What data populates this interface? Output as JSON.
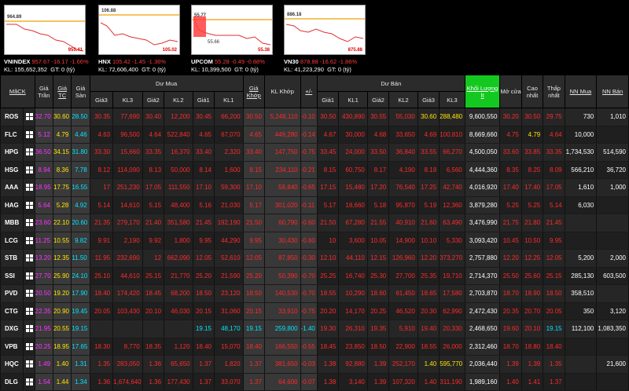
{
  "indices": [
    {
      "name": "VNINDEX",
      "value": "957.67",
      "change": "-16.17",
      "pct": "-1.66%",
      "kl": "KL: 155,652,352",
      "gt": "GT: 0 (tỷ)",
      "hi": "964.89",
      "lo": "955.41",
      "mid": ""
    },
    {
      "name": "HNX",
      "value": "105.42",
      "change": "-1.45",
      "pct": "-1.36%",
      "kl": "KL: 72,606,400",
      "gt": "GT: 0 (tỷ)",
      "hi": "106.88",
      "lo": "105.02",
      "mid": ""
    },
    {
      "name": "UPCOM",
      "value": "55.28",
      "change": "-0.49",
      "pct": "-0.88%",
      "kl": "KL: 10,399,500",
      "gt": "GT: 0 (tỷ)",
      "hi": "55.77",
      "lo": "55.38",
      "mid": "55.66"
    },
    {
      "name": "VN30",
      "value": "878.88",
      "change": "-16.62",
      "pct": "-1.86%",
      "kl": "KL: 41,223,290",
      "gt": "GT: 0 (tỷ)",
      "hi": "886.18",
      "lo": "875.88",
      "mid": ""
    }
  ],
  "headers": {
    "mack": "MãCK",
    "tran": "Giá Trần",
    "tc": "Giá TC",
    "san": "Giá Sàn",
    "du_mua": "Dư Mua",
    "khop": "Giá Khớp",
    "kl_khop": "KL Khớp",
    "pm": "+/-",
    "du_ban": "Dư Bán",
    "kl_tong": "Khối Lượng lt",
    "mo": "Mở cửa",
    "cao": "Cao nhất",
    "thap": "Thấp nhất",
    "nn_mua": "NN Mua",
    "nn_ban": "NN Bán",
    "sub": [
      "Giá3",
      "KL3",
      "Giá2",
      "KL2",
      "Giá1",
      "KL1",
      "Giá1",
      "KL1",
      "Giá2",
      "KL2",
      "Giá3",
      "KL3"
    ]
  },
  "rows": [
    {
      "sym": "ROS",
      "v": [
        "32.70",
        "30.60",
        "28.50",
        "30.35",
        "77,690",
        "30.40",
        "12,200",
        "30.45",
        "66,200",
        "30.50",
        "5,248,110",
        "-0.10",
        "30.50",
        "430,890",
        "30.55",
        "55,030",
        "30.60",
        "288,480",
        "9,600,550",
        "30.20",
        "30.50",
        "29.75",
        "730",
        "1,010"
      ],
      "k": [
        "p",
        "y",
        "c",
        "r",
        "r",
        "r",
        "r",
        "r",
        "r",
        "r",
        "r",
        "r",
        "r",
        "r",
        "r",
        "r",
        "y",
        "y",
        "w",
        "r",
        "r",
        "r",
        "w",
        "w"
      ]
    },
    {
      "sym": "FLC",
      "v": [
        "5.12",
        "4.79",
        "4.46",
        "4.63",
        "96,500",
        "4.64",
        "522,840",
        "4.65",
        "67,070",
        "4.65",
        "449,280",
        "-0.14",
        "4.67",
        "30,000",
        "4.68",
        "33,650",
        "4.69",
        "100,810",
        "8,669,660",
        "4.75",
        "4.79",
        "4.64",
        "10,000",
        ""
      ],
      "k": [
        "p",
        "y",
        "c",
        "r",
        "r",
        "r",
        "r",
        "r",
        "r",
        "r",
        "r",
        "r",
        "r",
        "r",
        "r",
        "r",
        "r",
        "r",
        "w",
        "r",
        "y",
        "r",
        "w",
        "w"
      ]
    },
    {
      "sym": "HPG",
      "v": [
        "36.50",
        "34.15",
        "31.80",
        "33.30",
        "15,660",
        "33.35",
        "16,370",
        "33.40",
        "2,320",
        "33.40",
        "147,750",
        "-0.75",
        "33.45",
        "24,000",
        "33.50",
        "36,840",
        "33.55",
        "66,270",
        "4,500,050",
        "33.60",
        "33.85",
        "33.35",
        "1,734,530",
        "514,590"
      ],
      "k": [
        "p",
        "y",
        "c",
        "r",
        "r",
        "r",
        "r",
        "r",
        "r",
        "r",
        "r",
        "r",
        "r",
        "r",
        "r",
        "r",
        "r",
        "r",
        "w",
        "r",
        "r",
        "r",
        "w",
        "w"
      ]
    },
    {
      "sym": "HSG",
      "v": [
        "8.94",
        "8.36",
        "7.78",
        "8.12",
        "114,090",
        "8.13",
        "50,000",
        "8.14",
        "1,600",
        "8.15",
        "234,110",
        "-0.21",
        "8.15",
        "60,750",
        "8.17",
        "4,190",
        "8.18",
        "6,560",
        "4,444,360",
        "8.35",
        "8.25",
        "8.09",
        "566,210",
        "36,720"
      ],
      "k": [
        "p",
        "y",
        "c",
        "r",
        "r",
        "r",
        "r",
        "r",
        "r",
        "r",
        "r",
        "r",
        "r",
        "r",
        "r",
        "r",
        "r",
        "r",
        "w",
        "r",
        "r",
        "r",
        "w",
        "w"
      ]
    },
    {
      "sym": "AAA",
      "v": [
        "18.95",
        "17.75",
        "16.55",
        "17",
        "251,230",
        "17.05",
        "111,550",
        "17.10",
        "59,300",
        "17.10",
        "58,840",
        "-0.65",
        "17.15",
        "15,480",
        "17.20",
        "76,540",
        "17.25",
        "42,740",
        "4,016,920",
        "17.40",
        "17.40",
        "17.05",
        "1,610",
        "1,000"
      ],
      "k": [
        "p",
        "y",
        "c",
        "r",
        "r",
        "r",
        "r",
        "r",
        "r",
        "r",
        "r",
        "r",
        "r",
        "r",
        "r",
        "r",
        "r",
        "r",
        "w",
        "r",
        "r",
        "r",
        "w",
        "w"
      ]
    },
    {
      "sym": "HAG",
      "v": [
        "5.64",
        "5.28",
        "4.92",
        "5.14",
        "14,610",
        "5.15",
        "48,400",
        "5.16",
        "21,030",
        "5.17",
        "301,020",
        "-0.11",
        "5.17",
        "18,660",
        "5.18",
        "95,870",
        "5.19",
        "12,360",
        "3,879,280",
        "5.25",
        "5.25",
        "5.14",
        "6,030",
        ""
      ],
      "k": [
        "p",
        "y",
        "c",
        "r",
        "r",
        "r",
        "r",
        "r",
        "r",
        "r",
        "r",
        "r",
        "r",
        "r",
        "r",
        "r",
        "r",
        "r",
        "w",
        "r",
        "r",
        "r",
        "w",
        "w"
      ]
    },
    {
      "sym": "MBB",
      "v": [
        "23.60",
        "22.10",
        "20.60",
        "21.35",
        "279,170",
        "21.40",
        "351,580",
        "21.45",
        "192,190",
        "21.50",
        "60,790",
        "-0.60",
        "21.50",
        "67,280",
        "21.55",
        "40,910",
        "21.60",
        "63,490",
        "3,476,990",
        "21.75",
        "21.80",
        "21.45",
        "",
        ""
      ],
      "k": [
        "p",
        "y",
        "c",
        "r",
        "r",
        "r",
        "r",
        "r",
        "r",
        "r",
        "r",
        "r",
        "r",
        "r",
        "r",
        "r",
        "r",
        "r",
        "w",
        "r",
        "r",
        "r",
        "w",
        "w"
      ]
    },
    {
      "sym": "LCG",
      "v": [
        "11.25",
        "10.55",
        "9.82",
        "9.91",
        "2,190",
        "9.92",
        "1,800",
        "9.95",
        "44,290",
        "9.95",
        "30,430",
        "-0.60",
        "10",
        "3,600",
        "10.05",
        "14,900",
        "10.10",
        "5,330",
        "3,093,420",
        "10.45",
        "10.50",
        "9.95",
        "",
        ""
      ],
      "k": [
        "p",
        "y",
        "c",
        "r",
        "r",
        "r",
        "r",
        "r",
        "r",
        "r",
        "r",
        "r",
        "r",
        "r",
        "r",
        "r",
        "r",
        "r",
        "w",
        "r",
        "r",
        "r",
        "w",
        "w"
      ]
    },
    {
      "sym": "STB",
      "v": [
        "13.20",
        "12.35",
        "11.50",
        "11.95",
        "232,690",
        "12",
        "662,090",
        "12.05",
        "52,610",
        "12.05",
        "87,850",
        "-0.30",
        "12.10",
        "44,110",
        "12.15",
        "126,960",
        "12.20",
        "373,270",
        "2,757,880",
        "12.20",
        "12.25",
        "12.05",
        "5,200",
        "2,000"
      ],
      "k": [
        "p",
        "y",
        "c",
        "r",
        "r",
        "r",
        "r",
        "r",
        "r",
        "r",
        "r",
        "r",
        "r",
        "r",
        "r",
        "r",
        "r",
        "r",
        "w",
        "r",
        "r",
        "r",
        "w",
        "w"
      ]
    },
    {
      "sym": "SSI",
      "v": [
        "27.70",
        "25.90",
        "24.10",
        "25.10",
        "44,610",
        "25.15",
        "21,770",
        "25.20",
        "21,590",
        "25.20",
        "50,390",
        "-0.70",
        "25.25",
        "16,740",
        "25.30",
        "27,700",
        "25.35",
        "19,710",
        "2,714,370",
        "25.50",
        "25.60",
        "25.15",
        "285,130",
        "603,500"
      ],
      "k": [
        "p",
        "y",
        "c",
        "r",
        "r",
        "r",
        "r",
        "r",
        "r",
        "r",
        "r",
        "r",
        "r",
        "r",
        "r",
        "r",
        "r",
        "r",
        "w",
        "r",
        "r",
        "r",
        "w",
        "w"
      ]
    },
    {
      "sym": "PVD",
      "v": [
        "20.50",
        "19.20",
        "17.90",
        "18.40",
        "174,420",
        "18.45",
        "68,200",
        "18.50",
        "23,120",
        "18.50",
        "140,530",
        "-0.70",
        "18.55",
        "10,290",
        "18.60",
        "61,450",
        "18.65",
        "17,580",
        "2,703,870",
        "18.70",
        "18.90",
        "18.50",
        "358,510",
        ""
      ],
      "k": [
        "p",
        "y",
        "c",
        "r",
        "r",
        "r",
        "r",
        "r",
        "r",
        "r",
        "r",
        "r",
        "r",
        "r",
        "r",
        "r",
        "r",
        "r",
        "w",
        "r",
        "r",
        "r",
        "w",
        "w"
      ]
    },
    {
      "sym": "CTG",
      "v": [
        "22.35",
        "20.90",
        "19.45",
        "20.05",
        "103,430",
        "20.10",
        "46,030",
        "20.15",
        "31,060",
        "20.15",
        "33,910",
        "-0.75",
        "20.20",
        "14,170",
        "20.25",
        "46,520",
        "20.30",
        "62,990",
        "2,472,430",
        "20.35",
        "20.70",
        "20.05",
        "350",
        "3,120"
      ],
      "k": [
        "p",
        "y",
        "c",
        "r",
        "r",
        "r",
        "r",
        "r",
        "r",
        "r",
        "r",
        "r",
        "r",
        "r",
        "r",
        "r",
        "r",
        "r",
        "w",
        "r",
        "r",
        "r",
        "w",
        "w"
      ]
    },
    {
      "sym": "DXG",
      "v": [
        "21.95",
        "20.55",
        "19.15",
        "",
        "",
        "",
        "",
        "19.15",
        "48,170",
        "19.15",
        "259,800",
        "-1.40",
        "19.30",
        "26,310",
        "19.35",
        "5,910",
        "19.40",
        "20,330",
        "2,468,650",
        "19.60",
        "20.10",
        "19.15",
        "112,100",
        "1,083,350"
      ],
      "k": [
        "p",
        "y",
        "c",
        "r",
        "r",
        "r",
        "r",
        "c",
        "c",
        "c",
        "c",
        "c",
        "r",
        "r",
        "r",
        "r",
        "r",
        "r",
        "w",
        "r",
        "r",
        "c",
        "w",
        "w"
      ]
    },
    {
      "sym": "VPB",
      "v": [
        "20.25",
        "18.95",
        "17.65",
        "18.30",
        "8,770",
        "18.35",
        "1,120",
        "18.40",
        "15,070",
        "18.40",
        "166,550",
        "-0.55",
        "18.45",
        "23,850",
        "18.50",
        "22,900",
        "18.55",
        "26,000",
        "2,312,460",
        "18.70",
        "18.80",
        "18.40",
        "",
        ""
      ],
      "k": [
        "p",
        "y",
        "c",
        "r",
        "r",
        "r",
        "r",
        "r",
        "r",
        "r",
        "r",
        "r",
        "r",
        "r",
        "r",
        "r",
        "r",
        "r",
        "w",
        "r",
        "r",
        "r",
        "w",
        "w"
      ]
    },
    {
      "sym": "HQC",
      "v": [
        "1.49",
        "1.40",
        "1.31",
        "1.35",
        "283,050",
        "1.36",
        "65,650",
        "1.37",
        "1,820",
        "1.37",
        "381,650",
        "-0.03",
        "1.38",
        "92,880",
        "1.39",
        "252,170",
        "1.40",
        "595,770",
        "2,036,440",
        "1.39",
        "1.39",
        "1.35",
        "",
        "21,600"
      ],
      "k": [
        "p",
        "y",
        "c",
        "r",
        "r",
        "r",
        "r",
        "r",
        "r",
        "r",
        "r",
        "r",
        "r",
        "r",
        "r",
        "r",
        "y",
        "y",
        "w",
        "r",
        "r",
        "r",
        "w",
        "w"
      ]
    },
    {
      "sym": "DLG",
      "v": [
        "1.54",
        "1.44",
        "1.34",
        "1.36",
        "1,674,640",
        "1.36",
        "177,430",
        "1.37",
        "33,070",
        "1.37",
        "64,600",
        "-0.07",
        "1.38",
        "3,140",
        "1.39",
        "107,320",
        "1.40",
        "311,190",
        "1,989,160",
        "1.40",
        "1.41",
        "1.37",
        "",
        ""
      ],
      "k": [
        "p",
        "y",
        "c",
        "r",
        "r",
        "r",
        "r",
        "r",
        "r",
        "r",
        "r",
        "r",
        "r",
        "r",
        "r",
        "r",
        "r",
        "r",
        "w",
        "r",
        "r",
        "r",
        "w",
        "w"
      ]
    }
  ]
}
